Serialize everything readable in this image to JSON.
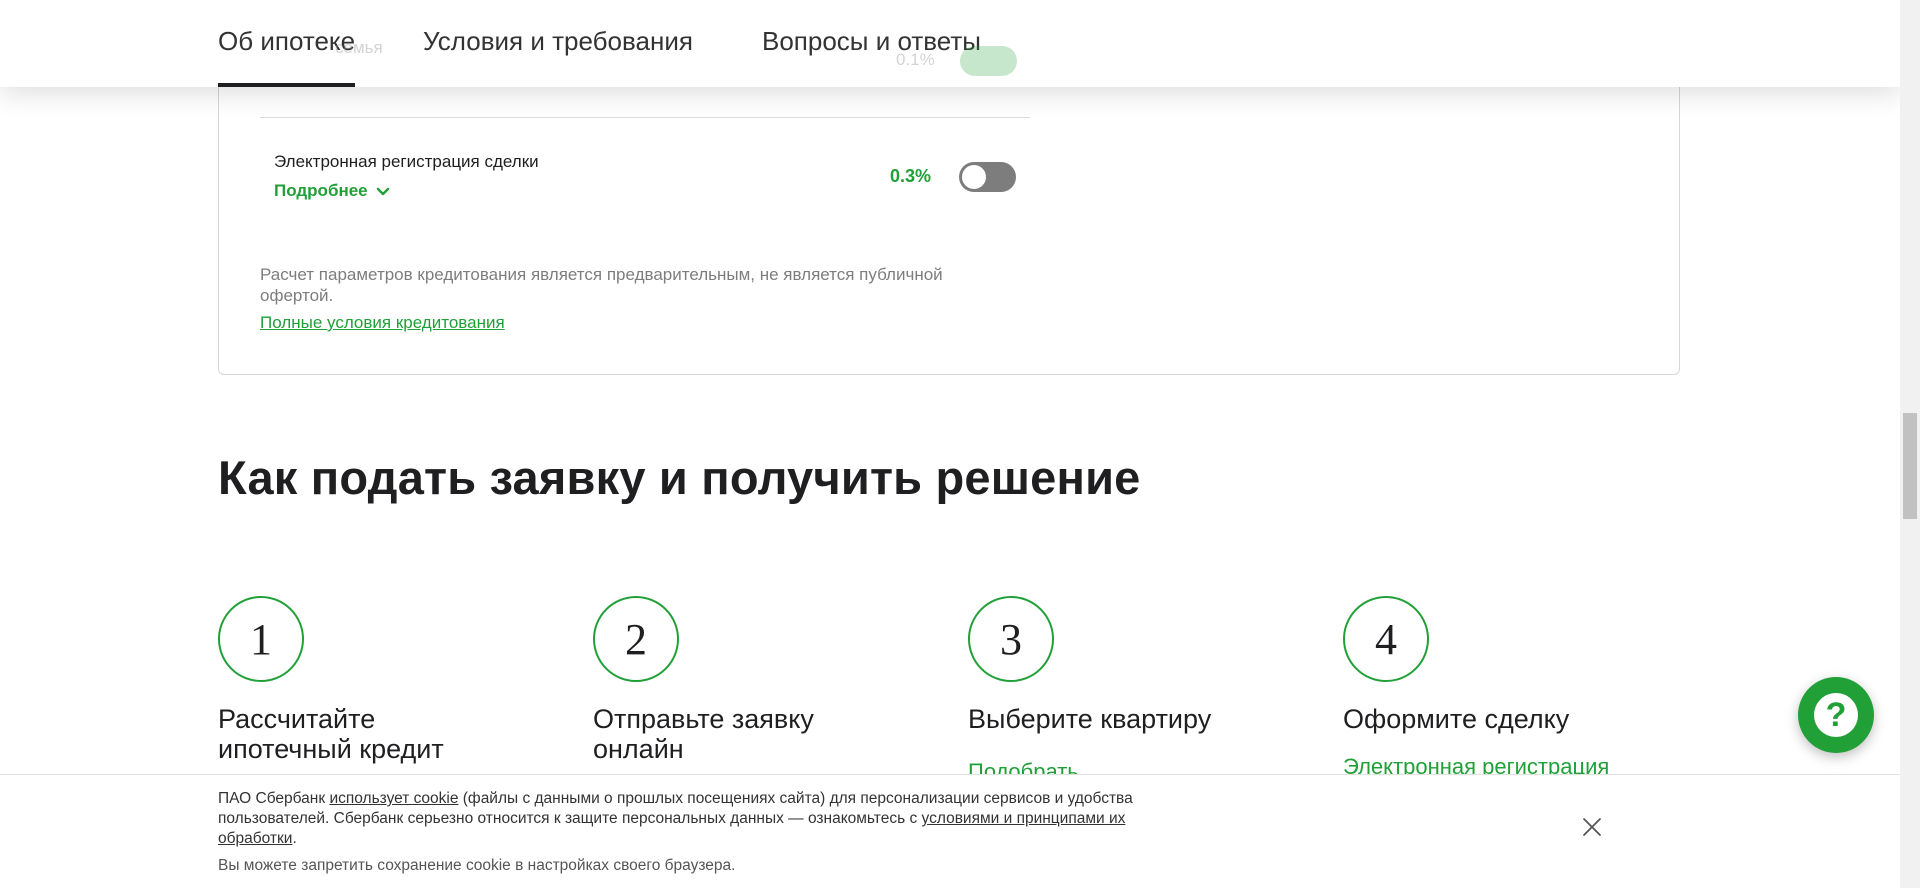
{
  "tabs": [
    {
      "label": "Об ипотеке",
      "active": true
    },
    {
      "label": "Условия и требования",
      "active": false
    },
    {
      "label": "Вопросы и ответы",
      "active": false
    }
  ],
  "hidden_row": {
    "title_fragment": "семья",
    "value_fragment": "0.1%"
  },
  "calculator": {
    "option": {
      "title": "Электронная регистрация сделки",
      "more_label": "Подробнее",
      "value": "0.3%",
      "toggle_on": false
    },
    "note": "Расчет параметров кредитования является предварительным, не является публичной офертой.",
    "terms_link": "Полные условия кредитования"
  },
  "section": {
    "title": "Как подать заявку и получить решение",
    "steps": [
      {
        "number": "1",
        "title": "Рассчитайте ипотечный кредит",
        "link": ""
      },
      {
        "number": "2",
        "title": "Отправьте заявку онлайн",
        "link": ""
      },
      {
        "number": "3",
        "title": "Выберите квартиру",
        "link": "Подобрать"
      },
      {
        "number": "4",
        "title": "Оформите сделку",
        "link": "Электронная регистрация"
      }
    ]
  },
  "chat": {
    "icon": "question-icon",
    "glyph": "?"
  },
  "cookie": {
    "text_1": "ПАО Сбербанк ",
    "link_1": "использует cookie",
    "text_2": " (файлы с данными о прошлых посещениях сайта) для персонализации сервисов и удобства пользователей. Сбербанк серьезно относится к защите персональных данных — ознакомьтесь с ",
    "link_2": "условиями и принципами их обработки",
    "text_3": ".",
    "note": "Вы можете запретить сохранение cookie в настройках своего браузера."
  },
  "colors": {
    "accent": "#21a038",
    "text": "#1f1f22",
    "toggle_off": "#7d7d7d"
  }
}
